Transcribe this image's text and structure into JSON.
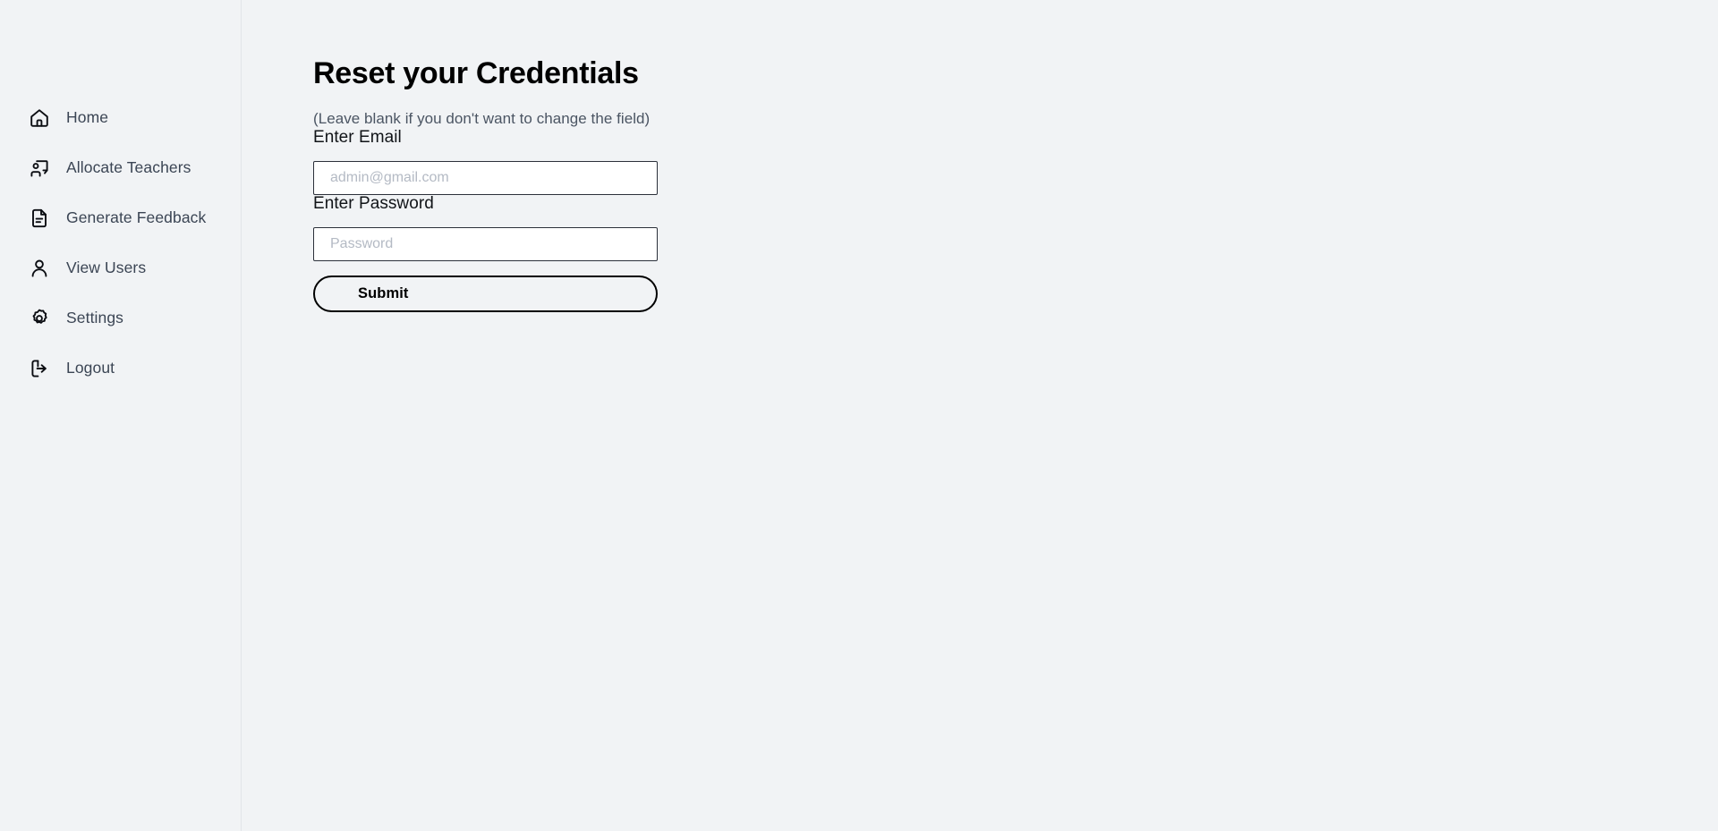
{
  "theme": {
    "page_background": "#f1f3f5",
    "sidebar_background": "#f1f3f5",
    "sidebar_divider": "#e2e5e9",
    "text_primary": "#000000",
    "text_secondary": "#4b5563",
    "nav_label_color": "#3b4554",
    "icon_color": "#0b0d12",
    "input_background": "#ffffff",
    "input_border": "#2b303a",
    "placeholder_color": "#b4bac4",
    "button_border": "#000000"
  },
  "sidebar": {
    "items": [
      {
        "label": "Home",
        "icon": "home-icon"
      },
      {
        "label": "Allocate Teachers",
        "icon": "presentation-user-icon"
      },
      {
        "label": "Generate Feedback",
        "icon": "document-text-icon"
      },
      {
        "label": "View Users",
        "icon": "user-icon"
      },
      {
        "label": "Settings",
        "icon": "gear-icon"
      },
      {
        "label": "Logout",
        "icon": "logout-icon"
      }
    ]
  },
  "main": {
    "title": "Reset your Credentials",
    "subtitle": "(Leave blank if you don't want to change the field)",
    "fields": {
      "email": {
        "label": "Enter Email",
        "placeholder": "admin@gmail.com",
        "value": "",
        "type": "email"
      },
      "password": {
        "label": "Enter Password",
        "placeholder": "Password",
        "value": "",
        "type": "password"
      }
    },
    "submit_label": "Submit"
  }
}
